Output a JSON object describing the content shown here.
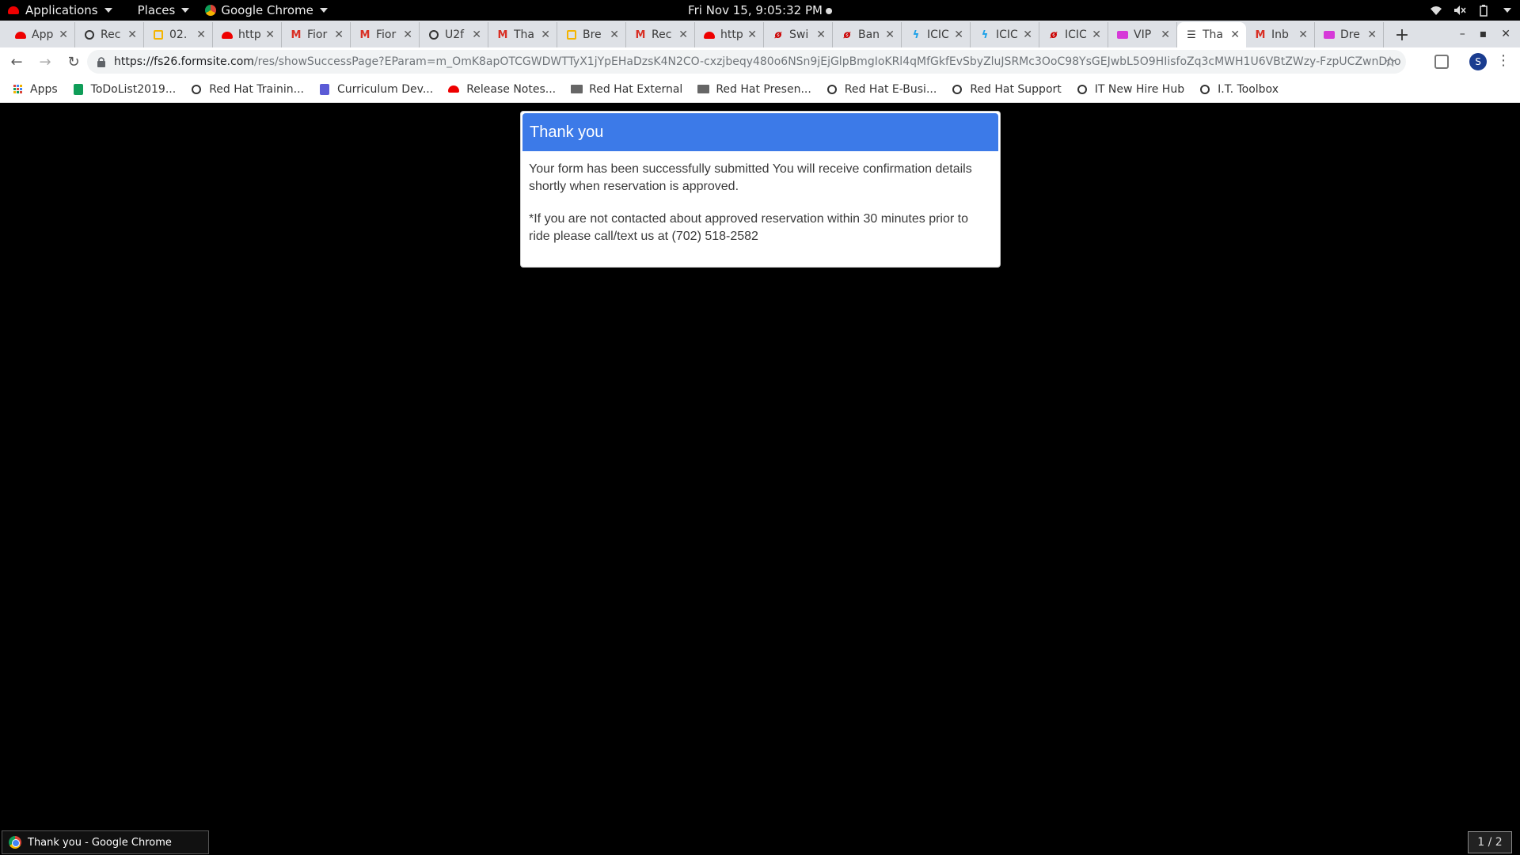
{
  "topbar": {
    "applications": "Applications",
    "places": "Places",
    "app_menu": "Google Chrome",
    "clock": "Fri Nov 15,  9:05:32 PM"
  },
  "tabs": [
    {
      "title": "App",
      "icon": "redhat-icon"
    },
    {
      "title": "Rec",
      "icon": "globe-icon"
    },
    {
      "title": "02.",
      "icon": "slides-icon"
    },
    {
      "title": "http",
      "icon": "redhat-icon"
    },
    {
      "title": "Fior",
      "icon": "gmail-icon"
    },
    {
      "title": "Fior",
      "icon": "gmail-icon"
    },
    {
      "title": "U2f",
      "icon": "globe-icon"
    },
    {
      "title": "Tha",
      "icon": "gmail-icon"
    },
    {
      "title": "Bre",
      "icon": "slides-icon"
    },
    {
      "title": "Rec",
      "icon": "gmail-icon"
    },
    {
      "title": "http",
      "icon": "redhat-icon"
    },
    {
      "title": "Swi",
      "icon": "redhat-swirl-icon"
    },
    {
      "title": "Ban",
      "icon": "redhat-swirl-icon"
    },
    {
      "title": "ICIC",
      "icon": "bolt-icon"
    },
    {
      "title": "ICIC",
      "icon": "bolt-icon"
    },
    {
      "title": "ICIC",
      "icon": "redhat-swirl-icon"
    },
    {
      "title": "VIP",
      "icon": "video-icon"
    },
    {
      "title": "Tha",
      "icon": "form-icon",
      "active": true
    },
    {
      "title": "Inb",
      "icon": "gmail-icon"
    },
    {
      "title": "Dre",
      "icon": "video-icon"
    }
  ],
  "address": {
    "host": "https://fs26.formsite.com",
    "path": "/res/showSuccessPage?EParam=m_OmK8apOTCGWDWTTyX1jYpEHaDzsK4N2CO-cxzjbeqy480o6NSn9jEjGlpBmgIoKRl4qMfGkfEvSbyZluJSRMc3OoC98YsGEJwbL5O9HIisfoZq3cMWH1U6VBtZWzy-FzpUCZwnDno"
  },
  "profile_initial": "S",
  "bookmarks": [
    {
      "label": "Apps",
      "icon": "apps-grid-icon"
    },
    {
      "label": "ToDoList2019...",
      "icon": "sheets-icon"
    },
    {
      "label": "Red Hat Trainin...",
      "icon": "globe-icon"
    },
    {
      "label": "Curriculum Dev...",
      "icon": "docs-icon"
    },
    {
      "label": "Release Notes...",
      "icon": "redhat-icon"
    },
    {
      "label": "Red Hat External",
      "icon": "folder-icon"
    },
    {
      "label": "Red Hat Presen...",
      "icon": "folder-icon"
    },
    {
      "label": "Red Hat E-Busi...",
      "icon": "globe-icon"
    },
    {
      "label": "Red Hat Support",
      "icon": "globe-icon"
    },
    {
      "label": "IT New Hire Hub",
      "icon": "globe-icon"
    },
    {
      "label": "I.T. Toolbox",
      "icon": "globe-icon"
    }
  ],
  "card": {
    "title": "Thank you",
    "message": "Your form has been successfully submitted You will receive confirmation details shortly when reservation is approved.",
    "note": "*If you are not contacted about approved reservation within 30 minutes prior to ride please call/text us at (702) 518-2582"
  },
  "taskbar": {
    "window_title": "Thank you - Google Chrome",
    "workspace": "1 / 2"
  },
  "colors": {
    "card_header": "#3c7ae8",
    "background": "#000000",
    "tabstrip": "#dee1e6"
  }
}
